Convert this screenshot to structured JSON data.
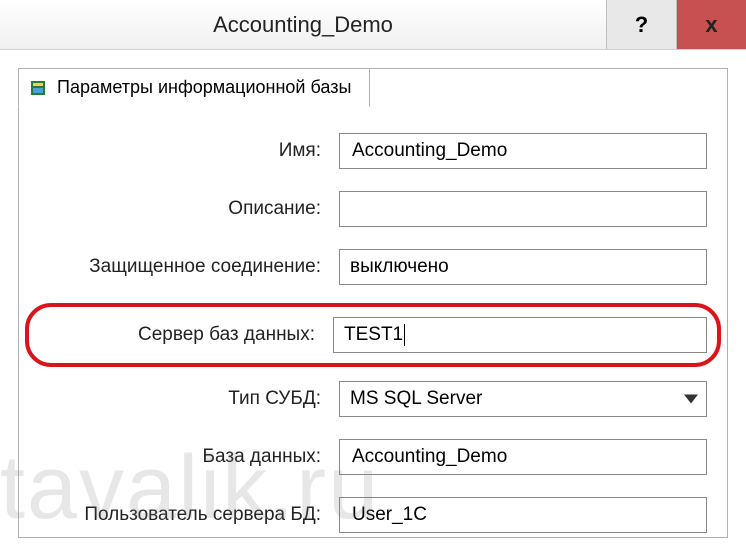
{
  "titlebar": {
    "title": "Accounting_Demo",
    "help": "?",
    "close": "x"
  },
  "tab": {
    "label": "Параметры информационной базы"
  },
  "fields": {
    "name_label": "Имя:",
    "name_value": "Accounting_Demo",
    "desc_label": "Описание:",
    "desc_value": "",
    "secure_label": "Защищенное соединение:",
    "secure_value": "выключено",
    "dbserver_label": "Сервер баз данных:",
    "dbserver_value": "TEST1",
    "dbtype_label": "Тип СУБД:",
    "dbtype_value": "MS SQL Server",
    "dbname_label": "База данных:",
    "dbname_value": "Accounting_Demo",
    "dbuser_label": "Пользователь сервера БД:",
    "dbuser_value": "User_1C"
  },
  "watermark": "tavalik.ru"
}
